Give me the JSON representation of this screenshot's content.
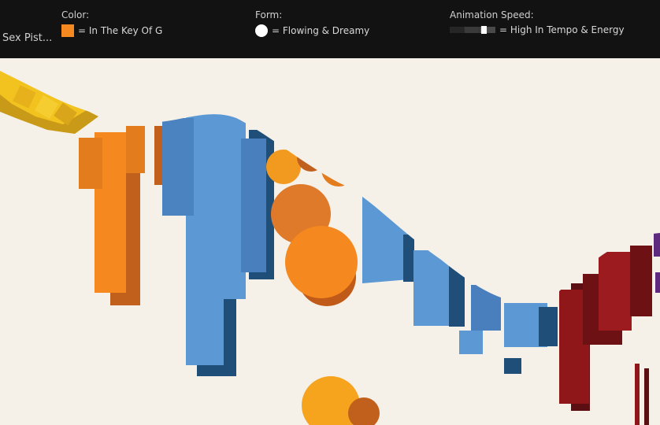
{
  "header": {
    "artist": "Sex Pist...",
    "color_legend": {
      "title": "Color:",
      "label": "= In The Key Of G",
      "swatch_color": "#f5891f"
    },
    "form_legend": {
      "title": "Form:",
      "label": "= Flowing & Dreamy",
      "icon": "circle-icon"
    },
    "speed_legend": {
      "title": "Animation Speed:",
      "label": "= High In Tempo & Energy",
      "level": 0.75
    }
  },
  "colors": {
    "background": "#f5f1e9",
    "yellow": "#f2c21e",
    "orange": "#f5891f",
    "blue": "#5b98d4",
    "red": "#9b1b1e",
    "purple": "#5e2a80"
  }
}
